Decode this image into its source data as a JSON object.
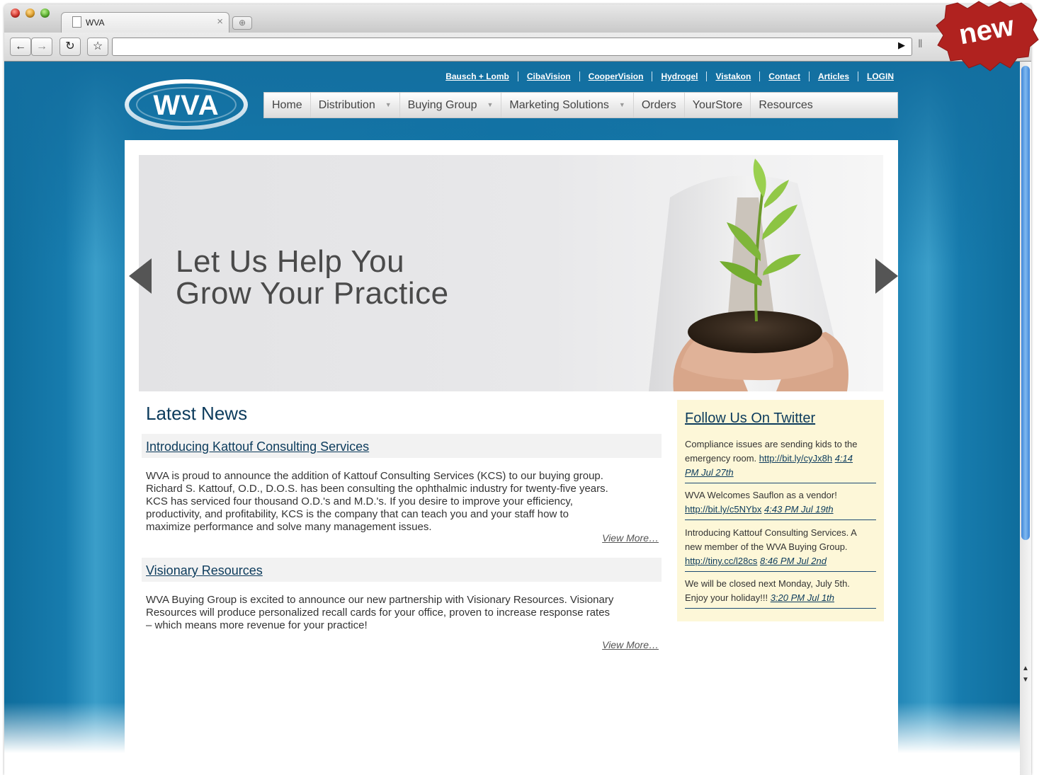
{
  "browser": {
    "tab_title": "WVA",
    "url": ""
  },
  "site": {
    "logo_text": "WVA",
    "top_links": [
      "Bausch + Lomb",
      "CibaVision",
      "CooperVision",
      "Hydrogel",
      "Vistakon",
      "Contact",
      "Articles",
      "LOGIN"
    ],
    "nav": [
      {
        "label": "Home",
        "has_dropdown": false
      },
      {
        "label": "Distribution",
        "has_dropdown": true
      },
      {
        "label": "Buying Group",
        "has_dropdown": true
      },
      {
        "label": "Marketing Solutions",
        "has_dropdown": true
      },
      {
        "label": "Orders",
        "has_dropdown": false
      },
      {
        "label": "YourStore",
        "has_dropdown": false
      },
      {
        "label": "Resources",
        "has_dropdown": false
      }
    ]
  },
  "hero": {
    "line1": "Let Us Help You",
    "line2": "Grow Your Practice"
  },
  "news": {
    "heading": "Latest News",
    "articles": [
      {
        "title": "Introducing Kattouf Consulting Services",
        "lines": [
          "WVA is proud to announce the addition of Kattouf Consulting Services (KCS) to our buying group.",
          "Richard S. Kattouf, O.D., D.O.S. has been consulting the ophthalmic industry for twenty-five years.",
          "KCS has serviced four thousand O.D.'s and M.D.'s. If you desire to improve your efficiency,",
          "productivity, and profitability, KCS is the company that can teach you and your staff how to",
          "maximize performance and solve many management issues."
        ],
        "more": "View More…"
      },
      {
        "title": "Visionary Resources",
        "lines": [
          "WVA Buying Group is excited to announce our new partnership with Visionary Resources. Visionary",
          "Resources will produce personalized recall cards for your office, proven to increase response rates",
          "– which means more revenue for your practice!"
        ],
        "more": "View More…"
      }
    ]
  },
  "twitter": {
    "heading": "Follow Us On Twitter",
    "tweets": [
      {
        "lines": [
          "Compliance issues are sending kids to the",
          "emergency room. "
        ],
        "link": "http://bit.ly/cyJx8h",
        "time": "4:14 PM Jul 27th",
        "time_parts": [
          "4:14",
          "PM Jul 27th"
        ]
      },
      {
        "lines": [
          "WVA Welcomes Sauflon as a vendor!"
        ],
        "link": "http://bit.ly/c5NYbx",
        "time": "4:43 PM Jul 19th"
      },
      {
        "lines": [
          "Introducing Kattouf Consulting Services. A",
          "new member of the WVA Buying Group."
        ],
        "link": "http://tiny.cc/l28cs",
        "time": "8:46 PM Jul 2nd"
      },
      {
        "lines": [
          "We will be closed next Monday, July 5th.",
          "Enjoy your holiday!!! "
        ],
        "link": "",
        "time": "3:20 PM Jul 1th"
      }
    ]
  },
  "badge": {
    "text": "new",
    "color": "#b0221f"
  },
  "colors": {
    "page_blue": "#1179ac",
    "heading_navy": "#0c3b5c",
    "twitter_bg": "#fdf7d8"
  }
}
